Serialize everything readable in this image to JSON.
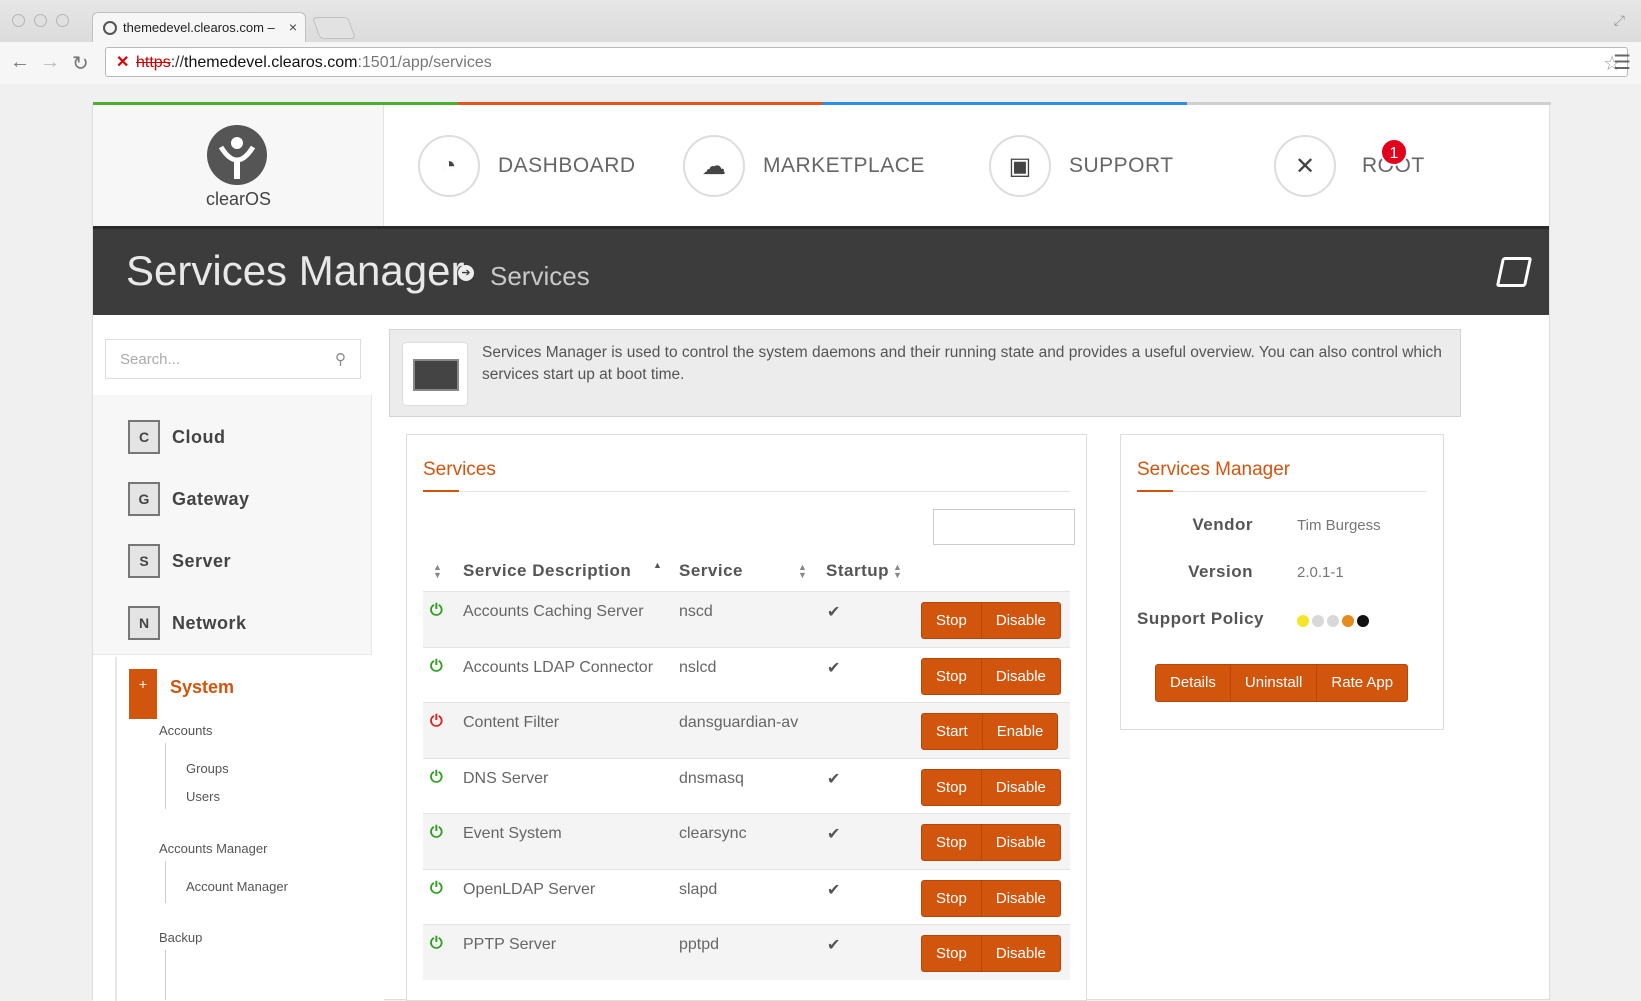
{
  "browser": {
    "tab_title": "themedevel.clearos.com –",
    "url_scheme": "https",
    "url_sep": "://",
    "url_host": "themedevel.clearos.com",
    "url_path": ":1501/app/services",
    "tab_close": "×"
  },
  "header": {
    "logo_text": "clearOS",
    "top_accent_colors": [
      "#4caf2f",
      "#e5541b",
      "#2f8ee5",
      "#cfcfcf"
    ],
    "nav": [
      {
        "label": "DASHBOARD",
        "icon": "dashboard-gauge-icon"
      },
      {
        "label": "MARKETPLACE",
        "icon": "cloud-download-icon"
      },
      {
        "label": "SUPPORT",
        "icon": "inbox-tray-icon"
      },
      {
        "label": "ROOT",
        "icon": "tools-icon",
        "badge": "1"
      }
    ]
  },
  "titlebar": {
    "title": "Services Manager",
    "breadcrumb": "Services"
  },
  "sidebar": {
    "search_placeholder": "Search...",
    "categories": [
      {
        "letter": "C",
        "label": "Cloud"
      },
      {
        "letter": "G",
        "label": "Gateway"
      },
      {
        "letter": "S",
        "label": "Server"
      },
      {
        "letter": "N",
        "label": "Network"
      }
    ],
    "active_category": {
      "letter": "+",
      "label": "System"
    },
    "subsections": [
      {
        "title": "Accounts",
        "items": [
          "Groups",
          "Users"
        ]
      },
      {
        "title": "Accounts Manager",
        "items": [
          "Account Manager"
        ]
      },
      {
        "title": "Backup",
        "items": []
      }
    ]
  },
  "intro": {
    "text": "Services Manager is used to control the system daemons and their running state and provides a useful overview. You can also control which services start up at boot time."
  },
  "services": {
    "title": "Services",
    "columns": [
      "Service Description",
      "Service",
      "Startup"
    ],
    "rows": [
      {
        "description": "Accounts Caching Server",
        "service": "nscd",
        "running": true,
        "startup": "✔",
        "action": "Stop",
        "toggle": "Disable"
      },
      {
        "description": "Accounts LDAP Connector",
        "service": "nslcd",
        "running": true,
        "startup": "✔",
        "action": "Stop",
        "toggle": "Disable"
      },
      {
        "description": "Content Filter",
        "service": "dansguardian-av",
        "running": false,
        "startup": "",
        "action": "Start",
        "toggle": "Enable"
      },
      {
        "description": "DNS Server",
        "service": "dnsmasq",
        "running": true,
        "startup": "✔",
        "action": "Stop",
        "toggle": "Disable"
      },
      {
        "description": "Event System",
        "service": "clearsync",
        "running": true,
        "startup": "✔",
        "action": "Stop",
        "toggle": "Disable"
      },
      {
        "description": "OpenLDAP Server",
        "service": "slapd",
        "running": true,
        "startup": "✔",
        "action": "Stop",
        "toggle": "Disable"
      },
      {
        "description": "PPTP Server",
        "service": "pptpd",
        "running": true,
        "startup": "✔",
        "action": "Stop",
        "toggle": "Disable"
      }
    ],
    "colors": {
      "running": "#2e9e1e",
      "stopped": "#e02020",
      "accent": "#d2550e"
    }
  },
  "app_info": {
    "title": "Services Manager",
    "vendor_label": "Vendor",
    "vendor": "Tim Burgess",
    "version_label": "Version",
    "version": "2.0.1-1",
    "support_label": "Support Policy",
    "support_dots": [
      "#f5e52a",
      "#d8d8d8",
      "#d8d8d8",
      "#e58a1c",
      "#111111"
    ],
    "buttons": [
      "Details",
      "Uninstall",
      "Rate App"
    ]
  }
}
